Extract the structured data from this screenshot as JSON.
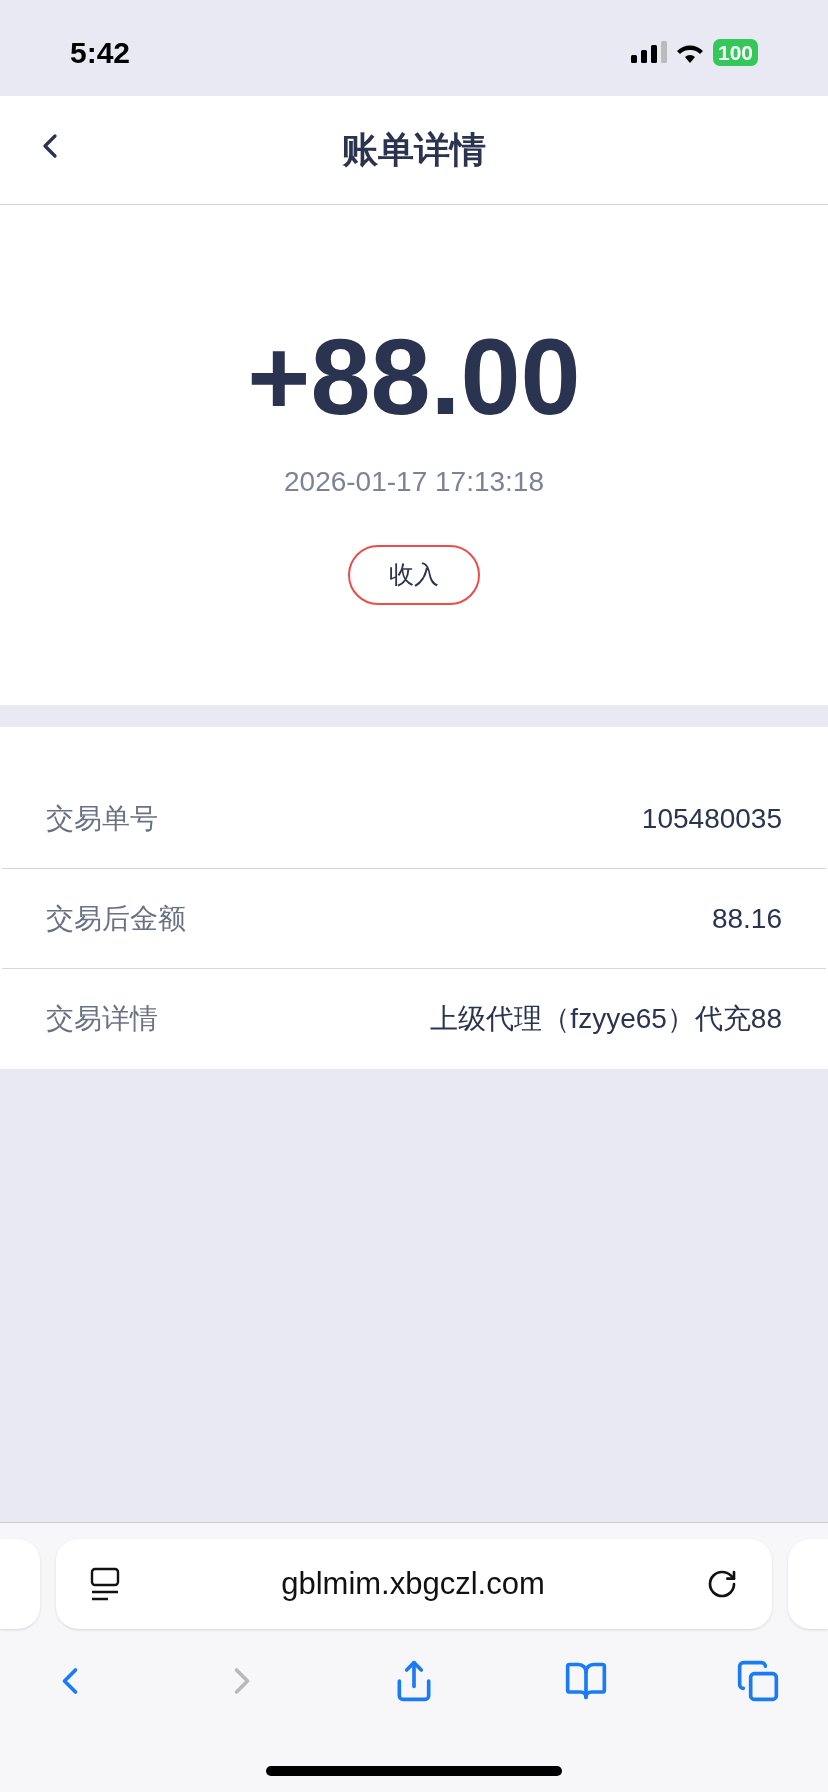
{
  "status_bar": {
    "time": "5:42",
    "battery": "100"
  },
  "header": {
    "title": "账单详情"
  },
  "summary": {
    "amount": "+88.00",
    "datetime": "2026-01-17 17:13:18",
    "tag": "收入"
  },
  "details": [
    {
      "label": "交易单号",
      "value": "105480035"
    },
    {
      "label": "交易后金额",
      "value": "88.16"
    },
    {
      "label": "交易详情",
      "value": "上级代理（fzyye65）代充88"
    }
  ],
  "browser": {
    "url": "gblmim.xbgczl.com",
    "toolbar": [
      {
        "kind": "back",
        "disabled": false
      },
      {
        "kind": "forward",
        "disabled": true
      },
      {
        "kind": "share",
        "disabled": false
      },
      {
        "kind": "bookmarks",
        "disabled": false
      },
      {
        "kind": "tabs",
        "disabled": false
      }
    ]
  }
}
